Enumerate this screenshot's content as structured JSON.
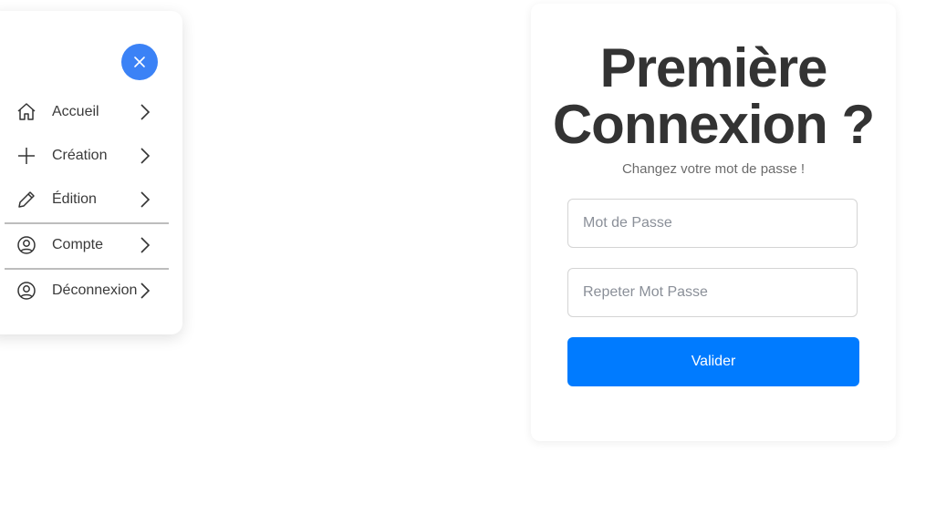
{
  "menu": {
    "close_icon": "close-icon",
    "items": [
      {
        "label": "Accueil",
        "icon": "home-icon"
      },
      {
        "label": "Création",
        "icon": "plus-icon"
      },
      {
        "label": "Édition",
        "icon": "pencil-icon"
      },
      {
        "label": "Compte",
        "icon": "user-circle-icon"
      },
      {
        "label": "Déconnexion",
        "icon": "user-circle-icon"
      }
    ]
  },
  "card": {
    "title_line1": "Première",
    "title_line2": "Connexion ?",
    "subtitle": "Changez votre mot de passe !",
    "password_placeholder": "Mot de Passe",
    "repeat_placeholder": "Repeter Mot Passe",
    "submit_label": "Valider"
  },
  "colors": {
    "accent": "#3b82f6",
    "button": "#007bff",
    "title": "#333333"
  }
}
